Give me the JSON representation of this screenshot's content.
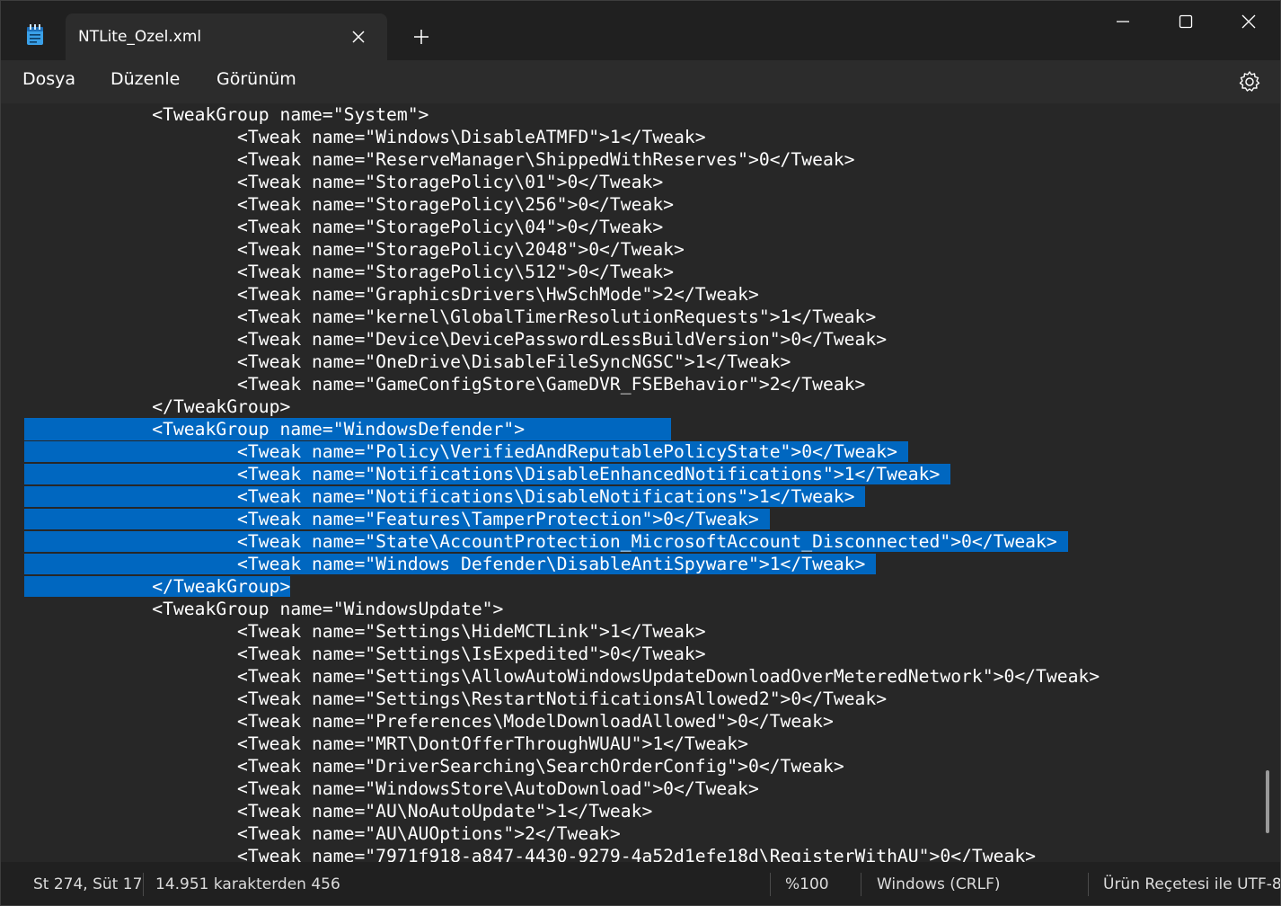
{
  "tab": {
    "title": "NTLite_Ozel.xml"
  },
  "menu": {
    "file": "Dosya",
    "edit": "Düzenle",
    "view": "Görünüm"
  },
  "editor": {
    "lines": [
      {
        "text": "            <TweakGroup name=\"System\">",
        "selected": false
      },
      {
        "text": "                    <Tweak name=\"Windows\\DisableATMFD\">1</Tweak>",
        "selected": false
      },
      {
        "text": "                    <Tweak name=\"ReserveManager\\ShippedWithReserves\">0</Tweak>",
        "selected": false
      },
      {
        "text": "                    <Tweak name=\"StoragePolicy\\01\">0</Tweak>",
        "selected": false
      },
      {
        "text": "                    <Tweak name=\"StoragePolicy\\256\">0</Tweak>",
        "selected": false
      },
      {
        "text": "                    <Tweak name=\"StoragePolicy\\04\">0</Tweak>",
        "selected": false
      },
      {
        "text": "                    <Tweak name=\"StoragePolicy\\2048\">0</Tweak>",
        "selected": false
      },
      {
        "text": "                    <Tweak name=\"StoragePolicy\\512\">0</Tweak>",
        "selected": false
      },
      {
        "text": "                    <Tweak name=\"GraphicsDrivers\\HwSchMode\">2</Tweak>",
        "selected": false
      },
      {
        "text": "                    <Tweak name=\"kernel\\GlobalTimerResolutionRequests\">1</Tweak>",
        "selected": false
      },
      {
        "text": "                    <Tweak name=\"Device\\DevicePasswordLessBuildVersion\">0</Tweak>",
        "selected": false
      },
      {
        "text": "                    <Tweak name=\"OneDrive\\DisableFileSyncNGSC\">1</Tweak>",
        "selected": false
      },
      {
        "text": "                    <Tweak name=\"GameConfigStore\\GameDVR_FSEBehavior\">2</Tweak>",
        "selected": false
      },
      {
        "text": "            </TweakGroup>",
        "selected": false
      },
      {
        "text": "            <TweakGroup name=\"WindowsDefender\"> ",
        "selected": "full"
      },
      {
        "text": "                    <Tweak name=\"Policy\\VerifiedAndReputablePolicyState\">0</Tweak> ",
        "selected": "partial"
      },
      {
        "text": "                    <Tweak name=\"Notifications\\DisableEnhancedNotifications\">1</Tweak> ",
        "selected": "partial"
      },
      {
        "text": "                    <Tweak name=\"Notifications\\DisableNotifications\">1</Tweak> ",
        "selected": "partial"
      },
      {
        "text": "                    <Tweak name=\"Features\\TamperProtection\">0</Tweak> ",
        "selected": "partial"
      },
      {
        "text": "                    <Tweak name=\"State\\AccountProtection_MicrosoftAccount_Disconnected\">0</Tweak> ",
        "selected": "partial"
      },
      {
        "text": "                    <Tweak name=\"Windows Defender\\DisableAntiSpyware\">1</Tweak> ",
        "selected": "partial"
      },
      {
        "text": "            </TweakGroup>",
        "selected": "last"
      },
      {
        "text": "            <TweakGroup name=\"WindowsUpdate\">",
        "selected": false
      },
      {
        "text": "                    <Tweak name=\"Settings\\HideMCTLink\">1</Tweak>",
        "selected": false
      },
      {
        "text": "                    <Tweak name=\"Settings\\IsExpedited\">0</Tweak>",
        "selected": false
      },
      {
        "text": "                    <Tweak name=\"Settings\\AllowAutoWindowsUpdateDownloadOverMeteredNetwork\">0</Tweak>",
        "selected": false
      },
      {
        "text": "                    <Tweak name=\"Settings\\RestartNotificationsAllowed2\">0</Tweak>",
        "selected": false
      },
      {
        "text": "                    <Tweak name=\"Preferences\\ModelDownloadAllowed\">0</Tweak>",
        "selected": false
      },
      {
        "text": "                    <Tweak name=\"MRT\\DontOfferThroughWUAU\">1</Tweak>",
        "selected": false
      },
      {
        "text": "                    <Tweak name=\"DriverSearching\\SearchOrderConfig\">0</Tweak>",
        "selected": false
      },
      {
        "text": "                    <Tweak name=\"WindowsStore\\AutoDownload\">0</Tweak>",
        "selected": false
      },
      {
        "text": "                    <Tweak name=\"AU\\NoAutoUpdate\">1</Tweak>",
        "selected": false
      },
      {
        "text": "                    <Tweak name=\"AU\\AUOptions\">2</Tweak>",
        "selected": false
      },
      {
        "text": "                    <Tweak name=\"7971f918-a847-4430-9279-4a52d1efe18d\\RegisterWithAU\">0</Tweak>",
        "selected": false
      }
    ]
  },
  "status": {
    "position": "St 274, Süt 17",
    "selection": "14.951 karakterden 456",
    "zoom": "%100",
    "line_ending": "Windows (CRLF)",
    "encoding": "Ürün Reçetesi ile UTF-8"
  },
  "colors": {
    "selection": "#0067c0",
    "background": "#272727",
    "titlebar": "#202020"
  }
}
